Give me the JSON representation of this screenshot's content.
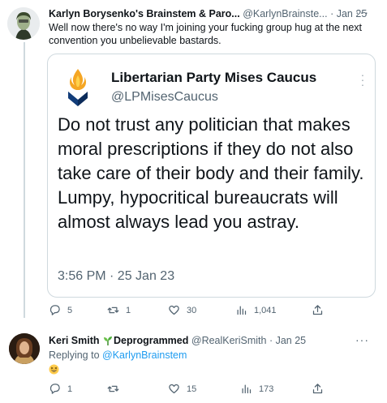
{
  "tweet1": {
    "display_name": "Karlyn Borysenko's Brainstem & Paro...",
    "handle": "@KarlynBrainste...",
    "separator": "·",
    "date": "Jan 25",
    "more": "···",
    "text": "Well now there's no way I'm joining your fucking group hug at the next convention you unbelievable bastards.",
    "quote": {
      "display_name": "Libertarian Party Mises Caucus",
      "handle": "@LPMisesCaucus",
      "text": "Do not trust any politician that makes moral prescriptions if they do not also take care of their body and their family. Lumpy, hypocritical bureaucrats will almost always lead you astray.",
      "timestamp": "3:56 PM · 25 Jan 23"
    },
    "actions": {
      "replies": "5",
      "retweets": "1",
      "likes": "30",
      "views": "1,041"
    }
  },
  "tweet2": {
    "display_name_pre": "Keri Smith",
    "display_name_post": "Deprogrammed",
    "handle": "@RealKeriSmith",
    "separator": "·",
    "date": "Jan 25",
    "more": "···",
    "replying_prefix": "Replying to",
    "replying_to": "@KarlynBrainstem",
    "actions": {
      "replies": "1",
      "retweets": "",
      "likes": "15",
      "views": "173"
    }
  },
  "icons": {
    "reply": "reply-icon",
    "retweet": "retweet-icon",
    "like": "heart-icon",
    "views": "views-icon",
    "share": "share-icon",
    "emoji": "grinning-squinting-face-emoji",
    "sprout": "seedling-emoji"
  },
  "colors": {
    "text": "#0f1419",
    "muted": "#536471",
    "link": "#1d9bf0",
    "border": "#cfd9de"
  }
}
